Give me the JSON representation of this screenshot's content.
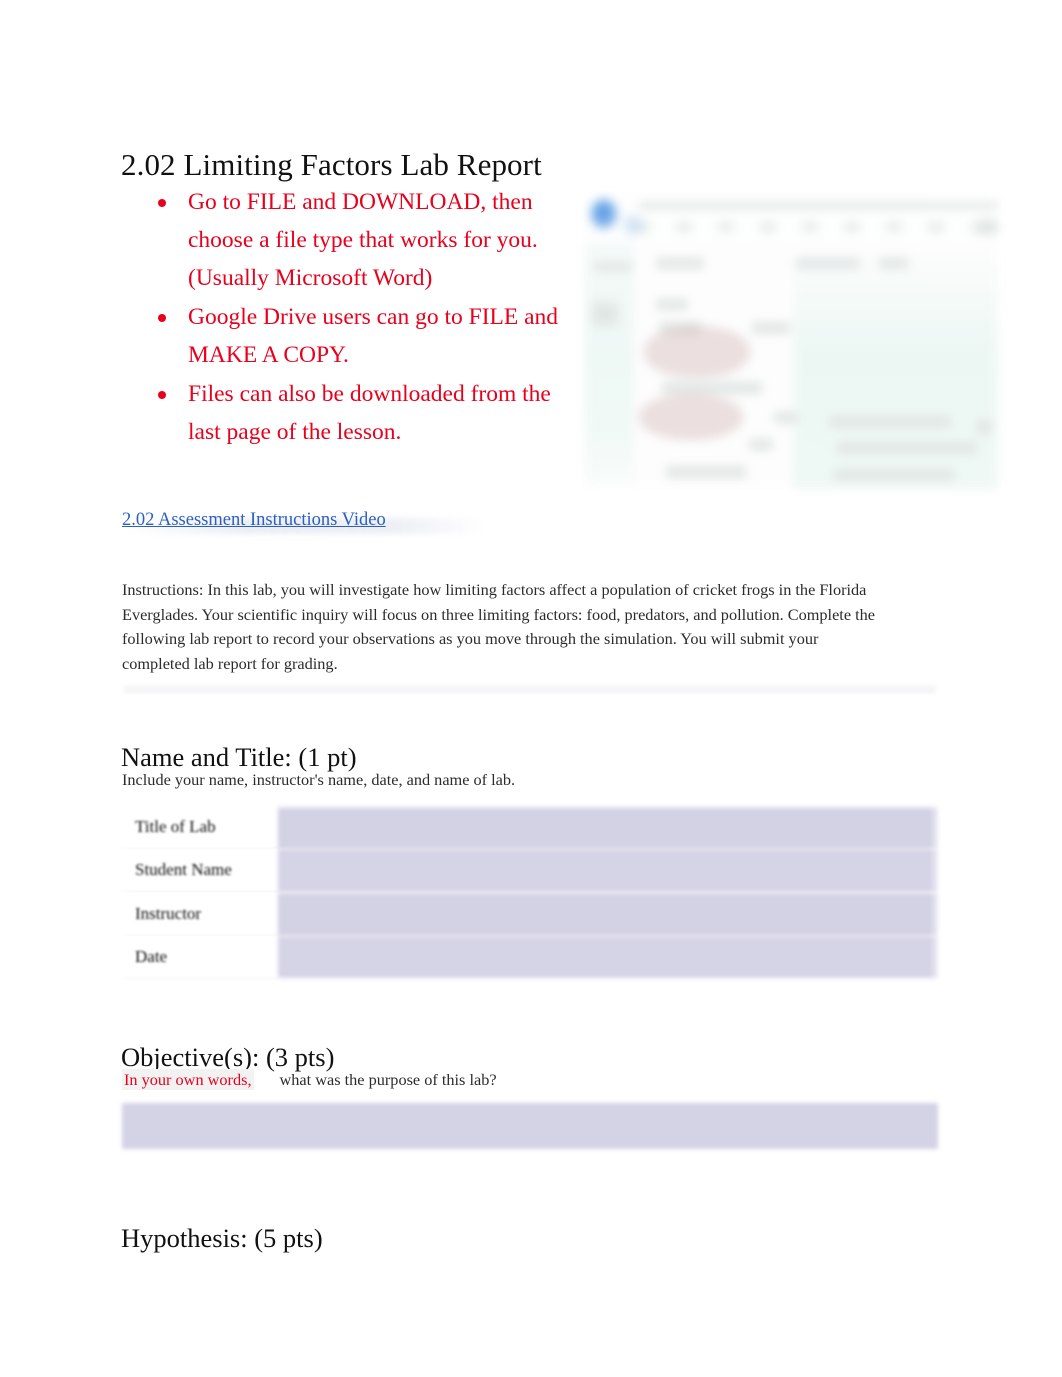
{
  "document": {
    "title": "2.02 Limiting Factors Lab Report",
    "page_background": "#ffffff",
    "accent_red": "#e8001c",
    "link_blue": "#2b5fc4",
    "field_lavender": "#d3d1e4"
  },
  "notice_bullets": [
    {
      "text": "Go to FILE and DOWNLOAD, then choose a file type that works for you. (Usually Microsoft Word)"
    },
    {
      "text": "Google Drive users can go to FILE and MAKE A COPY."
    },
    {
      "text": "Files can also be downloaded from the last page of the lesson."
    }
  ],
  "embedded_image": {
    "alt": "blurred screenshot of a document editor window"
  },
  "video_link": {
    "label": "2.02 Assessment Instructions Video"
  },
  "instructions": {
    "paragraph": "Instructions: In this lab, you will investigate how limiting factors affect a population of cricket frogs in the Florida Everglades. Your scientific inquiry will focus on three limiting factors: food, predators, and pollution. Complete the following lab report to record your observations as you move through the simulation. You will submit your completed lab report for grading."
  },
  "sections": {
    "name_and_title": {
      "heading": "Name and Title: (1 pt)",
      "note": "Include your name, instructor's name, date, and name of lab.",
      "table": {
        "rows": [
          {
            "label": "Title of Lab",
            "value": ""
          },
          {
            "label": "Student Name",
            "value": ""
          },
          {
            "label": "Instructor",
            "value": ""
          },
          {
            "label": "Date",
            "value": ""
          }
        ]
      }
    },
    "objectives": {
      "heading": "Objective(s): (3 pts)",
      "question_emphasis": "In your own words,",
      "question_rest": "what was the purpose of this lab?",
      "answer": ""
    },
    "hypothesis": {
      "heading": "Hypothesis: (5 pts)"
    }
  }
}
